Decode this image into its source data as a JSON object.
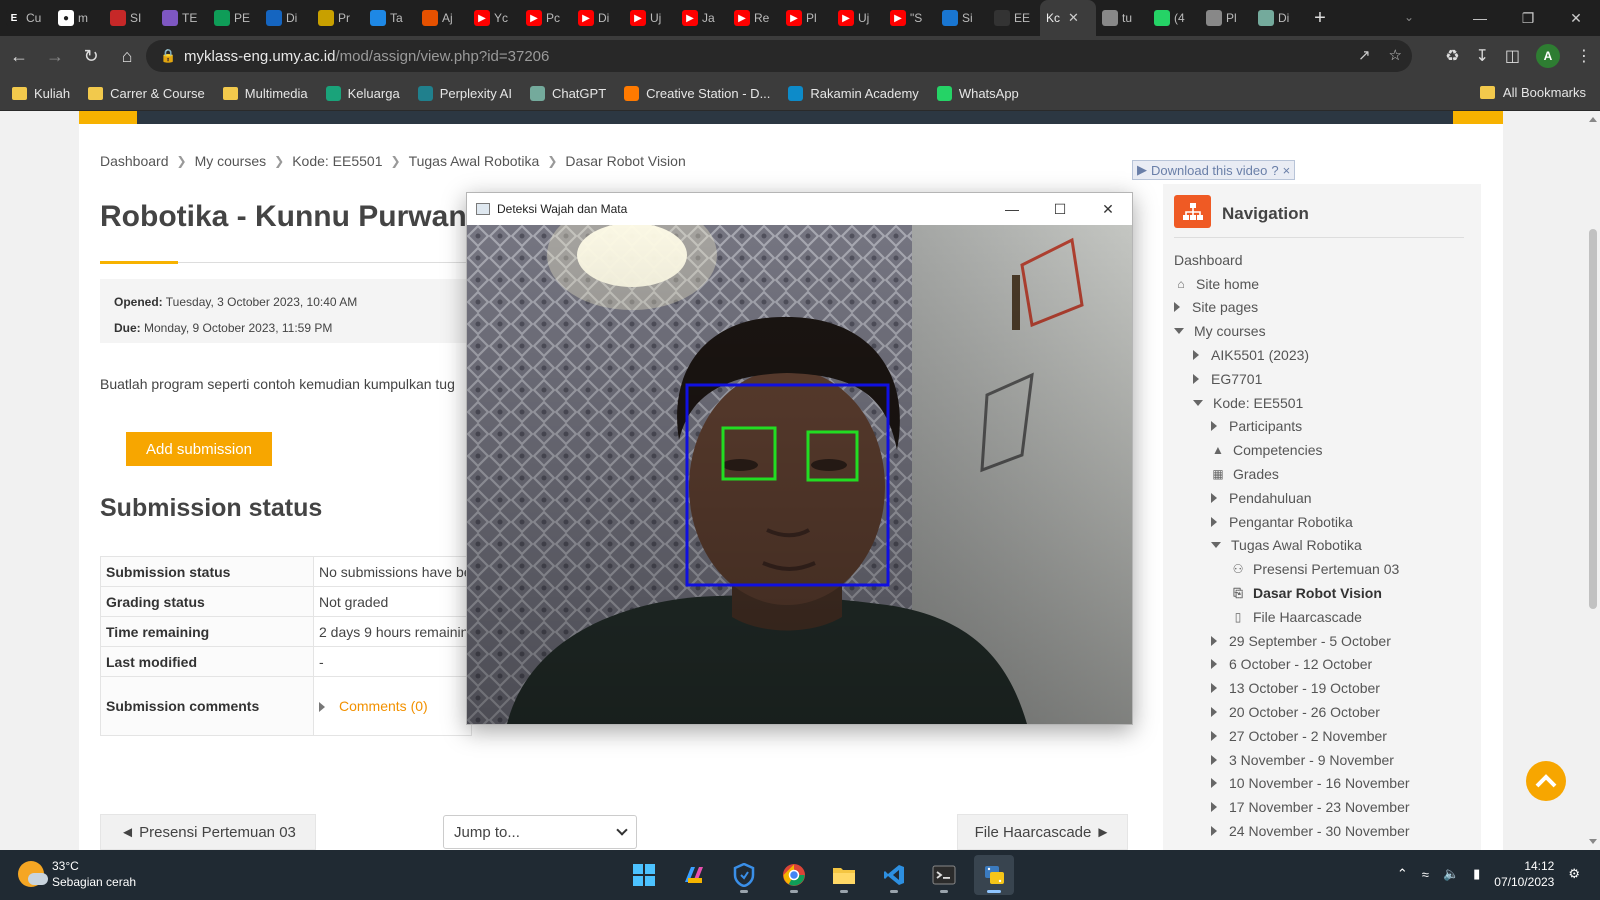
{
  "browser": {
    "tabs": [
      {
        "label": "Cu",
        "icon": "E",
        "color": "#1f1f1f"
      },
      {
        "label": "m",
        "icon": "github-icon",
        "color": "#ffffff"
      },
      {
        "label": "SI",
        "icon": "grid-icon",
        "color": "#c62828"
      },
      {
        "label": "TE",
        "icon": "forms-icon",
        "color": "#7e57c2"
      },
      {
        "label": "PE",
        "icon": "sheets-icon",
        "color": "#0f9d58"
      },
      {
        "label": "Di",
        "icon": "d-icon",
        "color": "#1565c0"
      },
      {
        "label": "Pr",
        "icon": "badge-icon",
        "color": "#c8a000"
      },
      {
        "label": "Ta",
        "icon": "arrow-icon",
        "color": "#1e88e5"
      },
      {
        "label": "Aj",
        "icon": "hammer-icon",
        "color": "#e65100"
      },
      {
        "label": "Yc",
        "icon": "youtube-icon",
        "color": "#ff0000"
      },
      {
        "label": "Pc",
        "icon": "youtube-icon",
        "color": "#ff0000"
      },
      {
        "label": "Di",
        "icon": "youtube-icon",
        "color": "#ff0000"
      },
      {
        "label": "Uj",
        "icon": "youtube-icon",
        "color": "#ff0000"
      },
      {
        "label": "Ja",
        "icon": "youtube-icon",
        "color": "#ff0000"
      },
      {
        "label": "Re",
        "icon": "youtube-icon",
        "color": "#ff0000"
      },
      {
        "label": "Pl",
        "icon": "youtube-icon",
        "color": "#ff0000"
      },
      {
        "label": "Uj",
        "icon": "youtube-icon",
        "color": "#ff0000"
      },
      {
        "label": "\"S",
        "icon": "youtube-icon",
        "color": "#ff0000"
      },
      {
        "label": "Si",
        "icon": "shield-icon",
        "color": "#1976d2"
      },
      {
        "label": "EE",
        "icon": "m-icon",
        "color": "#333333"
      },
      {
        "label": "Kc",
        "icon": "active",
        "color": "#3c3c3c"
      },
      {
        "label": "tu",
        "icon": "globe-icon",
        "color": "#888888"
      },
      {
        "label": "(4",
        "icon": "whatsapp-icon",
        "color": "#25d366"
      },
      {
        "label": "Pl",
        "icon": "globe-icon",
        "color": "#888888"
      },
      {
        "label": "Di",
        "icon": "chatgpt-icon",
        "color": "#74aa9c"
      }
    ],
    "url_host": "myklass-eng.umy.ac.id",
    "url_path": "/mod/assign/view.php?id=37206",
    "avatar_letter": "A",
    "bookmarks": [
      {
        "label": "Kuliah",
        "icon": "folder",
        "color": "#f2c94c"
      },
      {
        "label": "Carrer & Course",
        "icon": "folder",
        "color": "#f2c94c"
      },
      {
        "label": "Multimedia",
        "icon": "folder",
        "color": "#f2c94c"
      },
      {
        "label": "Keluarga",
        "icon": "site",
        "color": "#1aa37a"
      },
      {
        "label": "Perplexity AI",
        "icon": "site",
        "color": "#20808d"
      },
      {
        "label": "ChatGPT",
        "icon": "site",
        "color": "#74aa9c"
      },
      {
        "label": "Creative Station - D...",
        "icon": "site",
        "color": "#ff7a00"
      },
      {
        "label": "Rakamin Academy",
        "icon": "site",
        "color": "#0d8bc9"
      },
      {
        "label": "WhatsApp",
        "icon": "site",
        "color": "#25d366"
      }
    ],
    "all_bookmarks": "All Bookmarks"
  },
  "breadcrumb": [
    "Dashboard",
    "My courses",
    "Kode: EE5501",
    "Tugas Awal Robotika",
    "Dasar Robot Vision"
  ],
  "course_title": "Robotika - Kunnu Purwan",
  "dates": {
    "opened_label": "Opened:",
    "opened_value": "Tuesday, 3 October 2023, 10:40 AM",
    "due_label": "Due:",
    "due_value": "Monday, 9 October 2023, 11:59 PM"
  },
  "description": "Buatlah program seperti contoh kemudian kumpulkan tug",
  "add_submission_label": "Add submission",
  "submission_heading": "Submission status",
  "status_rows": [
    {
      "label": "Submission status",
      "value": "No submissions have be"
    },
    {
      "label": "Grading status",
      "value": "Not graded"
    },
    {
      "label": "Time remaining",
      "value": "2 days 9 hours remainin"
    },
    {
      "label": "Last modified",
      "value": "-"
    }
  ],
  "comments": {
    "label": "Submission comments",
    "link": "Comments (0)"
  },
  "prev_link": "◄ Presensi Pertemuan 03",
  "jump_to": "Jump to...",
  "next_link": "File Haarcascade ►",
  "navigation": {
    "title": "Navigation",
    "items": [
      {
        "label": "Dashboard",
        "level": 0,
        "kind": "none"
      },
      {
        "label": "Site home",
        "level": 0,
        "kind": "icon",
        "icon": "home-icon"
      },
      {
        "label": "Site pages",
        "level": 0,
        "kind": "collapsed"
      },
      {
        "label": "My courses",
        "level": 0,
        "kind": "expanded"
      },
      {
        "label": "AIK5501 (2023)",
        "level": 1,
        "kind": "collapsed"
      },
      {
        "label": "EG7701",
        "level": 1,
        "kind": "collapsed"
      },
      {
        "label": "Kode: EE5501",
        "level": 1,
        "kind": "expanded"
      },
      {
        "label": "Participants",
        "level": 2,
        "kind": "collapsed"
      },
      {
        "label": "Competencies",
        "level": 2,
        "kind": "icon",
        "icon": "competency-icon"
      },
      {
        "label": "Grades",
        "level": 2,
        "kind": "icon",
        "icon": "grades-icon"
      },
      {
        "label": "Pendahuluan",
        "level": 2,
        "kind": "collapsed"
      },
      {
        "label": "Pengantar Robotika",
        "level": 2,
        "kind": "collapsed"
      },
      {
        "label": "Tugas Awal Robotika",
        "level": 2,
        "kind": "expanded"
      },
      {
        "label": "Presensi Pertemuan 03",
        "level": 3,
        "kind": "icon",
        "icon": "attendance-icon"
      },
      {
        "label": "Dasar Robot Vision",
        "level": 3,
        "kind": "icon",
        "icon": "assignment-icon",
        "current": true
      },
      {
        "label": "File Haarcascade",
        "level": 3,
        "kind": "icon",
        "icon": "file-icon"
      },
      {
        "label": "29 September - 5 October",
        "level": 2,
        "kind": "collapsed"
      },
      {
        "label": "6 October - 12 October",
        "level": 2,
        "kind": "collapsed"
      },
      {
        "label": "13 October - 19 October",
        "level": 2,
        "kind": "collapsed"
      },
      {
        "label": "20 October - 26 October",
        "level": 2,
        "kind": "collapsed"
      },
      {
        "label": "27 October - 2 November",
        "level": 2,
        "kind": "collapsed"
      },
      {
        "label": "3 November - 9 November",
        "level": 2,
        "kind": "collapsed"
      },
      {
        "label": "10 November - 16 November",
        "level": 2,
        "kind": "collapsed"
      },
      {
        "label": "17 November - 23 November",
        "level": 2,
        "kind": "collapsed"
      },
      {
        "label": "24 November - 30 November",
        "level": 2,
        "kind": "collapsed"
      }
    ]
  },
  "download_video": "Download this video",
  "cv_window": {
    "title": "Deteksi Wajah dan Mata",
    "face_box_color": "#1010e0",
    "eye_box_color": "#22dd22"
  },
  "taskbar": {
    "temperature": "33°C",
    "weather": "Sebagian cerah",
    "time": "14:12",
    "date": "07/10/2023"
  }
}
